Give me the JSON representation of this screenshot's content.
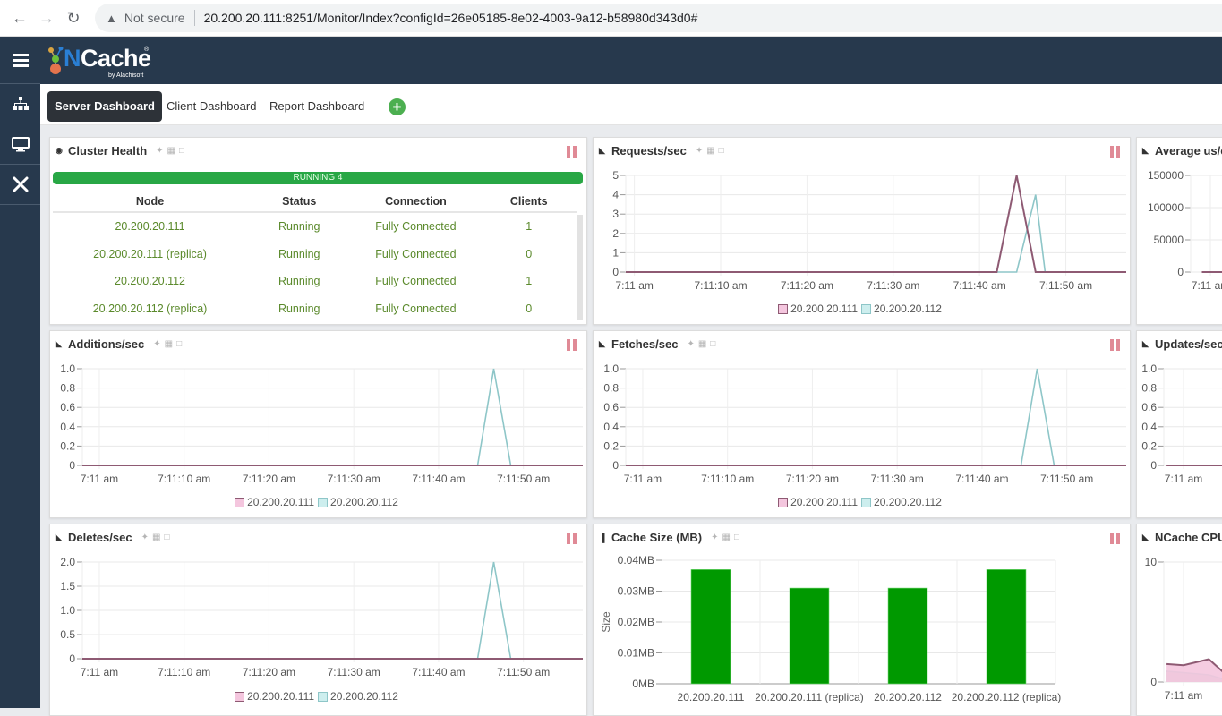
{
  "browser": {
    "security_label": "Not secure",
    "url_host": "20.200.20.111",
    "url_rest": ":8251/Monitor/Index?configId=26e05185-8e02-4003-9a12-b58980d343d0#"
  },
  "app": {
    "logo_text_n": "N",
    "logo_text_rest": "Cache",
    "logo_by": "by Alachisoft"
  },
  "tabs": [
    {
      "label": "Server Dashboard",
      "active": true
    },
    {
      "label": "Client Dashboard",
      "active": false
    },
    {
      "label": "Report Dashboard",
      "active": false
    }
  ],
  "add_tab_label": "+",
  "colors": {
    "series_111": "#8e5a73",
    "series_111_fill": "#f4c6de",
    "series_112": "#8ec6c8",
    "series_112_fill": "#cdeeee",
    "bar": "#009900",
    "running": "#28a745",
    "pause": "#e08a96"
  },
  "cluster_health": {
    "title": "Cluster Health",
    "status_bar": "RUNNING 4",
    "columns": [
      "Node",
      "Status",
      "Connection",
      "Clients"
    ],
    "rows": [
      [
        "20.200.20.111",
        "Running",
        "Fully Connected",
        "1"
      ],
      [
        "20.200.20.111 (replica)",
        "Running",
        "Fully Connected",
        "0"
      ],
      [
        "20.200.20.112",
        "Running",
        "Fully Connected",
        "1"
      ],
      [
        "20.200.20.112 (replica)",
        "Running",
        "Fully Connected",
        "0"
      ]
    ]
  },
  "legend": [
    "20.200.20.111",
    "20.200.20.112"
  ],
  "chart_data": [
    {
      "id": "requests",
      "title": "Requests/sec",
      "type": "line",
      "x_ticks": [
        "7:11 am",
        "7:11:10 am",
        "7:11:20 am",
        "7:11:30 am",
        "7:11:40 am",
        "7:11:50 am"
      ],
      "x_range_sec": [
        -1,
        57
      ],
      "ylim": [
        0,
        5
      ],
      "y_ticks": [
        "0",
        "1",
        "2",
        "3",
        "4",
        "5"
      ],
      "series": [
        {
          "name": "20.200.20.111",
          "points": [
            [
              -1,
              0
            ],
            [
              42,
              0
            ],
            [
              44.3,
              5
            ],
            [
              46.5,
              0
            ],
            [
              57,
              0
            ]
          ]
        },
        {
          "name": "20.200.20.112",
          "points": [
            [
              -1,
              0
            ],
            [
              44.3,
              0
            ],
            [
              46.5,
              4
            ],
            [
              47.6,
              0
            ],
            [
              57,
              0
            ]
          ]
        }
      ]
    },
    {
      "id": "average",
      "title": "Average us/cache operation",
      "type": "line",
      "x_ticks": [
        "7:11 am"
      ],
      "ylim": [
        0,
        150000
      ],
      "y_ticks": [
        "0",
        "50000",
        "100000",
        "150000"
      ],
      "series": [
        {
          "name": "20.200.20.111",
          "points": [
            [
              -1,
              0
            ],
            [
              57,
              0
            ]
          ]
        }
      ]
    },
    {
      "id": "additions",
      "title": "Additions/sec",
      "type": "line",
      "x_ticks": [
        "7:11 am",
        "7:11:10 am",
        "7:11:20 am",
        "7:11:30 am",
        "7:11:40 am",
        "7:11:50 am"
      ],
      "x_range_sec": [
        -2,
        57
      ],
      "ylim": [
        0,
        1
      ],
      "y_ticks": [
        "0",
        "0.2",
        "0.4",
        "0.6",
        "0.8",
        "1.0"
      ],
      "series": [
        {
          "name": "20.200.20.111",
          "points": [
            [
              -2,
              0
            ],
            [
              57,
              0
            ]
          ]
        },
        {
          "name": "20.200.20.112",
          "points": [
            [
              -2,
              0
            ],
            [
              44.6,
              0
            ],
            [
              46.5,
              1
            ],
            [
              48.5,
              0
            ],
            [
              57,
              0
            ]
          ]
        }
      ]
    },
    {
      "id": "fetches",
      "title": "Fetches/sec",
      "type": "line",
      "x_ticks": [
        "7:11 am",
        "7:11:10 am",
        "7:11:20 am",
        "7:11:30 am",
        "7:11:40 am",
        "7:11:50 am"
      ],
      "x_range_sec": [
        -2,
        57
      ],
      "ylim": [
        0,
        1
      ],
      "y_ticks": [
        "0",
        "0.2",
        "0.4",
        "0.6",
        "0.8",
        "1.0"
      ],
      "series": [
        {
          "name": "20.200.20.111",
          "points": [
            [
              -2,
              0
            ],
            [
              57,
              0
            ]
          ]
        },
        {
          "name": "20.200.20.112",
          "points": [
            [
              -2,
              0
            ],
            [
              44.6,
              0
            ],
            [
              46.5,
              1
            ],
            [
              48.5,
              0
            ],
            [
              57,
              0
            ]
          ]
        }
      ]
    },
    {
      "id": "updates",
      "title": "Updates/sec",
      "type": "line",
      "x_ticks": [
        "7:11 am"
      ],
      "ylim": [
        0,
        1
      ],
      "y_ticks": [
        "0",
        "0.2",
        "0.4",
        "0.6",
        "0.8",
        "1.0"
      ],
      "series": [
        {
          "name": "20.200.20.111",
          "points": [
            [
              -2,
              0
            ],
            [
              57,
              0
            ]
          ]
        }
      ]
    },
    {
      "id": "deletes",
      "title": "Deletes/sec",
      "type": "line",
      "x_ticks": [
        "7:11 am",
        "7:11:10 am",
        "7:11:20 am",
        "7:11:30 am",
        "7:11:40 am",
        "7:11:50 am"
      ],
      "x_range_sec": [
        -2,
        57
      ],
      "ylim": [
        0,
        2
      ],
      "y_ticks": [
        "0",
        "0.5",
        "1.0",
        "1.5",
        "2.0"
      ],
      "series": [
        {
          "name": "20.200.20.111",
          "points": [
            [
              -2,
              0
            ],
            [
              57,
              0
            ]
          ]
        },
        {
          "name": "20.200.20.112",
          "points": [
            [
              -2,
              0
            ],
            [
              44.6,
              0
            ],
            [
              46.5,
              2
            ],
            [
              48.5,
              0
            ],
            [
              57,
              0
            ]
          ]
        }
      ]
    },
    {
      "id": "cachesize",
      "title": "Cache Size (MB)",
      "type": "bar",
      "ylabel": "Size",
      "ylim": [
        0,
        0.04
      ],
      "y_ticks": [
        "0MB",
        "0.01MB",
        "0.02MB",
        "0.03MB",
        "0.04MB"
      ],
      "categories": [
        "20.200.20.111",
        "20.200.20.111 (replica)",
        "20.200.20.112",
        "20.200.20.112 (replica)"
      ],
      "values": [
        0.037,
        0.031,
        0.031,
        0.037
      ]
    },
    {
      "id": "cpu",
      "title": "NCache CPU",
      "type": "area",
      "x_ticks": [
        "7:11 am"
      ],
      "ylim": [
        0,
        10
      ],
      "y_ticks": [
        "0",
        "10"
      ],
      "series": [
        {
          "name": "20.200.20.111",
          "points": [
            [
              -2,
              1.5
            ],
            [
              0,
              1.4
            ],
            [
              3,
              1.9
            ],
            [
              6,
              0
            ]
          ]
        },
        {
          "name": "20.200.20.112",
          "points": [
            [
              -2,
              0.9
            ],
            [
              3,
              0.6
            ],
            [
              6,
              0
            ]
          ]
        }
      ]
    }
  ]
}
